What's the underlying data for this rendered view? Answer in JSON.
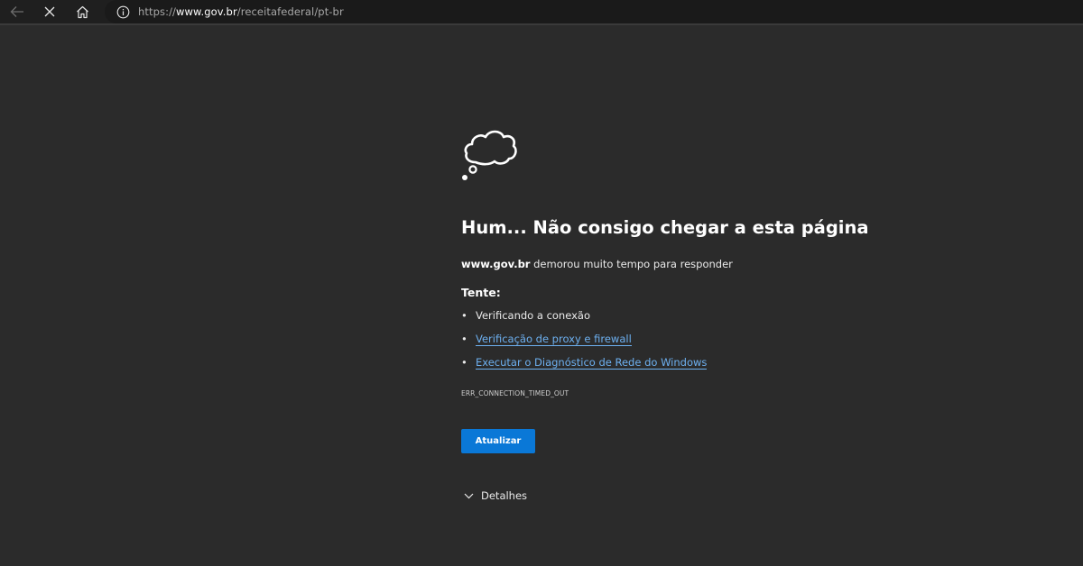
{
  "browser": {
    "url_prefix": "https://",
    "url_host": "www.gov.br",
    "url_path": "/receitafederal/pt-br"
  },
  "error_page": {
    "heading": "Hum... Não consigo chegar a esta página",
    "message_host": "www.gov.br",
    "message_text": " demorou muito tempo para responder",
    "try_label": "Tente:",
    "suggestions": [
      {
        "label": "Verificando a conexão",
        "is_link": false
      },
      {
        "label": "Verificação de proxy e firewall",
        "is_link": true
      },
      {
        "label": "Executar o Diagnóstico de Rede do Windows",
        "is_link": true
      }
    ],
    "error_code": "ERR_CONNECTION_TIMED_OUT",
    "refresh_label": "Atualizar",
    "details_label": "Detalhes"
  },
  "icons": {
    "back": "back-arrow-icon",
    "stop": "close-icon",
    "home": "home-icon",
    "info": "info-icon",
    "cloud": "thought-cloud-icon",
    "details": "chevron-down-icon"
  },
  "colors": {
    "background": "#2b2b2b",
    "toolbar": "#1f1f1f",
    "link": "#6db0f0",
    "button": "#0a78d7"
  }
}
